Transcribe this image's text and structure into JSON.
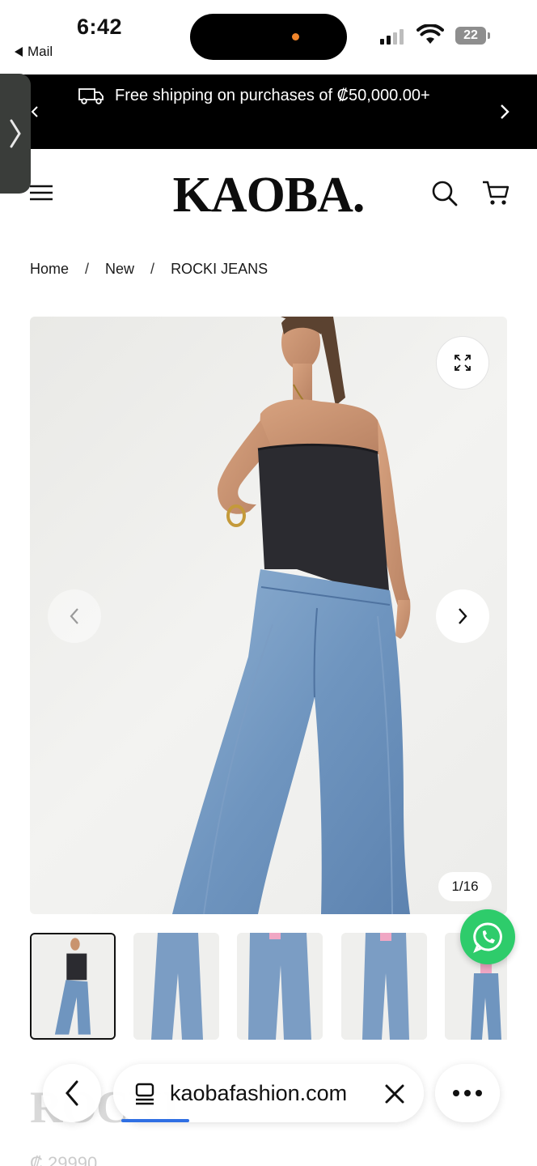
{
  "status_bar": {
    "time": "6:42",
    "back_app": "Mail",
    "battery": "22"
  },
  "promo": {
    "text": "Free shipping on purchases of ₡50,000.00+",
    "icon": "truck-icon"
  },
  "header": {
    "logo": "KAOBA.",
    "icons": [
      "menu-icon",
      "search-icon",
      "cart-icon"
    ]
  },
  "breadcrumb": {
    "items": [
      "Home",
      "New",
      "ROCKI JEANS"
    ],
    "separator": "/"
  },
  "gallery": {
    "counter": "1/16",
    "thumbnail_count_visible": 5
  },
  "product": {
    "title_partial": "ROCKI",
    "price_partial": "₡ 29990"
  },
  "browser": {
    "url": "kaobafashion.com",
    "load_progress": 0.22
  },
  "colors": {
    "promo_bg": "#000000",
    "whatsapp": "#2ecc6b",
    "progress": "#2f6fe3"
  }
}
